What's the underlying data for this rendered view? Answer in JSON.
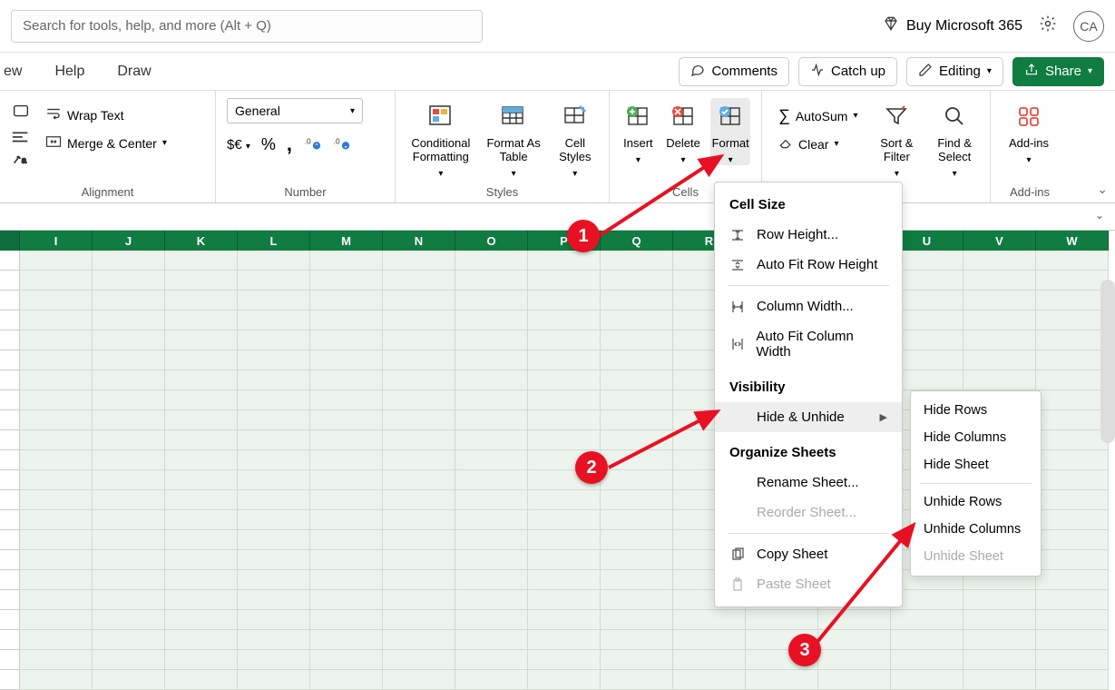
{
  "topbar": {
    "search_placeholder": "Search for tools, help, and more (Alt + Q)",
    "buy_label": "Buy Microsoft 365",
    "avatar_initials": "CA"
  },
  "menubar": {
    "tabs": [
      "ew",
      "Help",
      "Draw"
    ],
    "comments": "Comments",
    "catchup": "Catch up",
    "editing": "Editing",
    "share": "Share"
  },
  "ribbon": {
    "alignment": {
      "wrap": "Wrap Text",
      "merge": "Merge & Center",
      "group": "Alignment"
    },
    "number": {
      "format_selected": "General",
      "currency": "$€",
      "percent": "%",
      "comma": ",",
      "inc": "",
      "dec": "",
      "group": "Number"
    },
    "styles": {
      "conditional": "Conditional Formatting",
      "table": "Format As Table",
      "cellstyles": "Cell Styles",
      "group": "Styles"
    },
    "cells": {
      "insert": "Insert",
      "delete": "Delete",
      "format": "Format",
      "group": "Cells"
    },
    "editing_group": {
      "autosum": "AutoSum",
      "clear": "Clear",
      "sortfilter": "Sort & Filter",
      "findselect": "Find & Select"
    },
    "addins": {
      "label": "Add-ins",
      "group": "Add-ins"
    }
  },
  "columns": [
    "I",
    "J",
    "K",
    "L",
    "M",
    "N",
    "O",
    "P",
    "Q",
    "R",
    "",
    "",
    "U",
    "V",
    "W"
  ],
  "format_menu": {
    "headers": {
      "cellsize": "Cell Size",
      "visibility": "Visibility",
      "organize": "Organize Sheets"
    },
    "items": {
      "row_height": "Row Height...",
      "autofit_row": "Auto Fit Row Height",
      "col_width": "Column Width...",
      "autofit_col": "Auto Fit Column Width",
      "hide_unhide": "Hide & Unhide",
      "rename": "Rename Sheet...",
      "reorder": "Reorder Sheet...",
      "copy": "Copy Sheet",
      "paste": "Paste Sheet"
    }
  },
  "submenu": {
    "hide_rows": "Hide Rows",
    "hide_cols": "Hide Columns",
    "hide_sheet": "Hide Sheet",
    "unhide_rows": "Unhide Rows",
    "unhide_cols": "Unhide Columns",
    "unhide_sheet": "Unhide Sheet"
  },
  "annotations": {
    "b1": "1",
    "b2": "2",
    "b3": "3"
  }
}
